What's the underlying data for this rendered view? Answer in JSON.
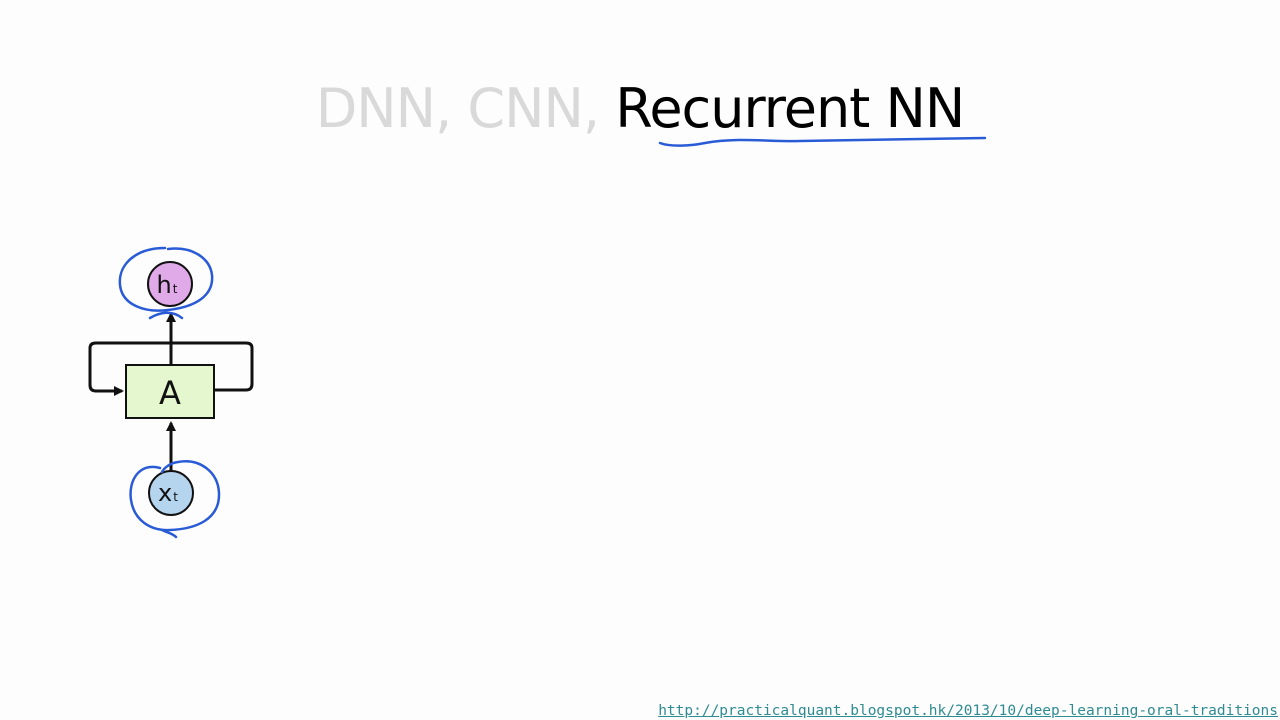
{
  "title": {
    "faded_part": "DNN, CNN,",
    "active_part": "Recurrent NN"
  },
  "diagram": {
    "cell_label": "A",
    "output_label": "h",
    "output_subscript": "t",
    "input_label": "x",
    "input_subscript": "t",
    "colors": {
      "cell_fill": "#e4f7cf",
      "output_fill": "#e0a9e8",
      "input_fill": "#b5d4ee",
      "annotation": "#2a5bd7",
      "stroke": "#111111"
    }
  },
  "source": {
    "url_text": "http://practicalquant.blogspot.hk/2013/10/deep-learning-oral-traditions"
  }
}
